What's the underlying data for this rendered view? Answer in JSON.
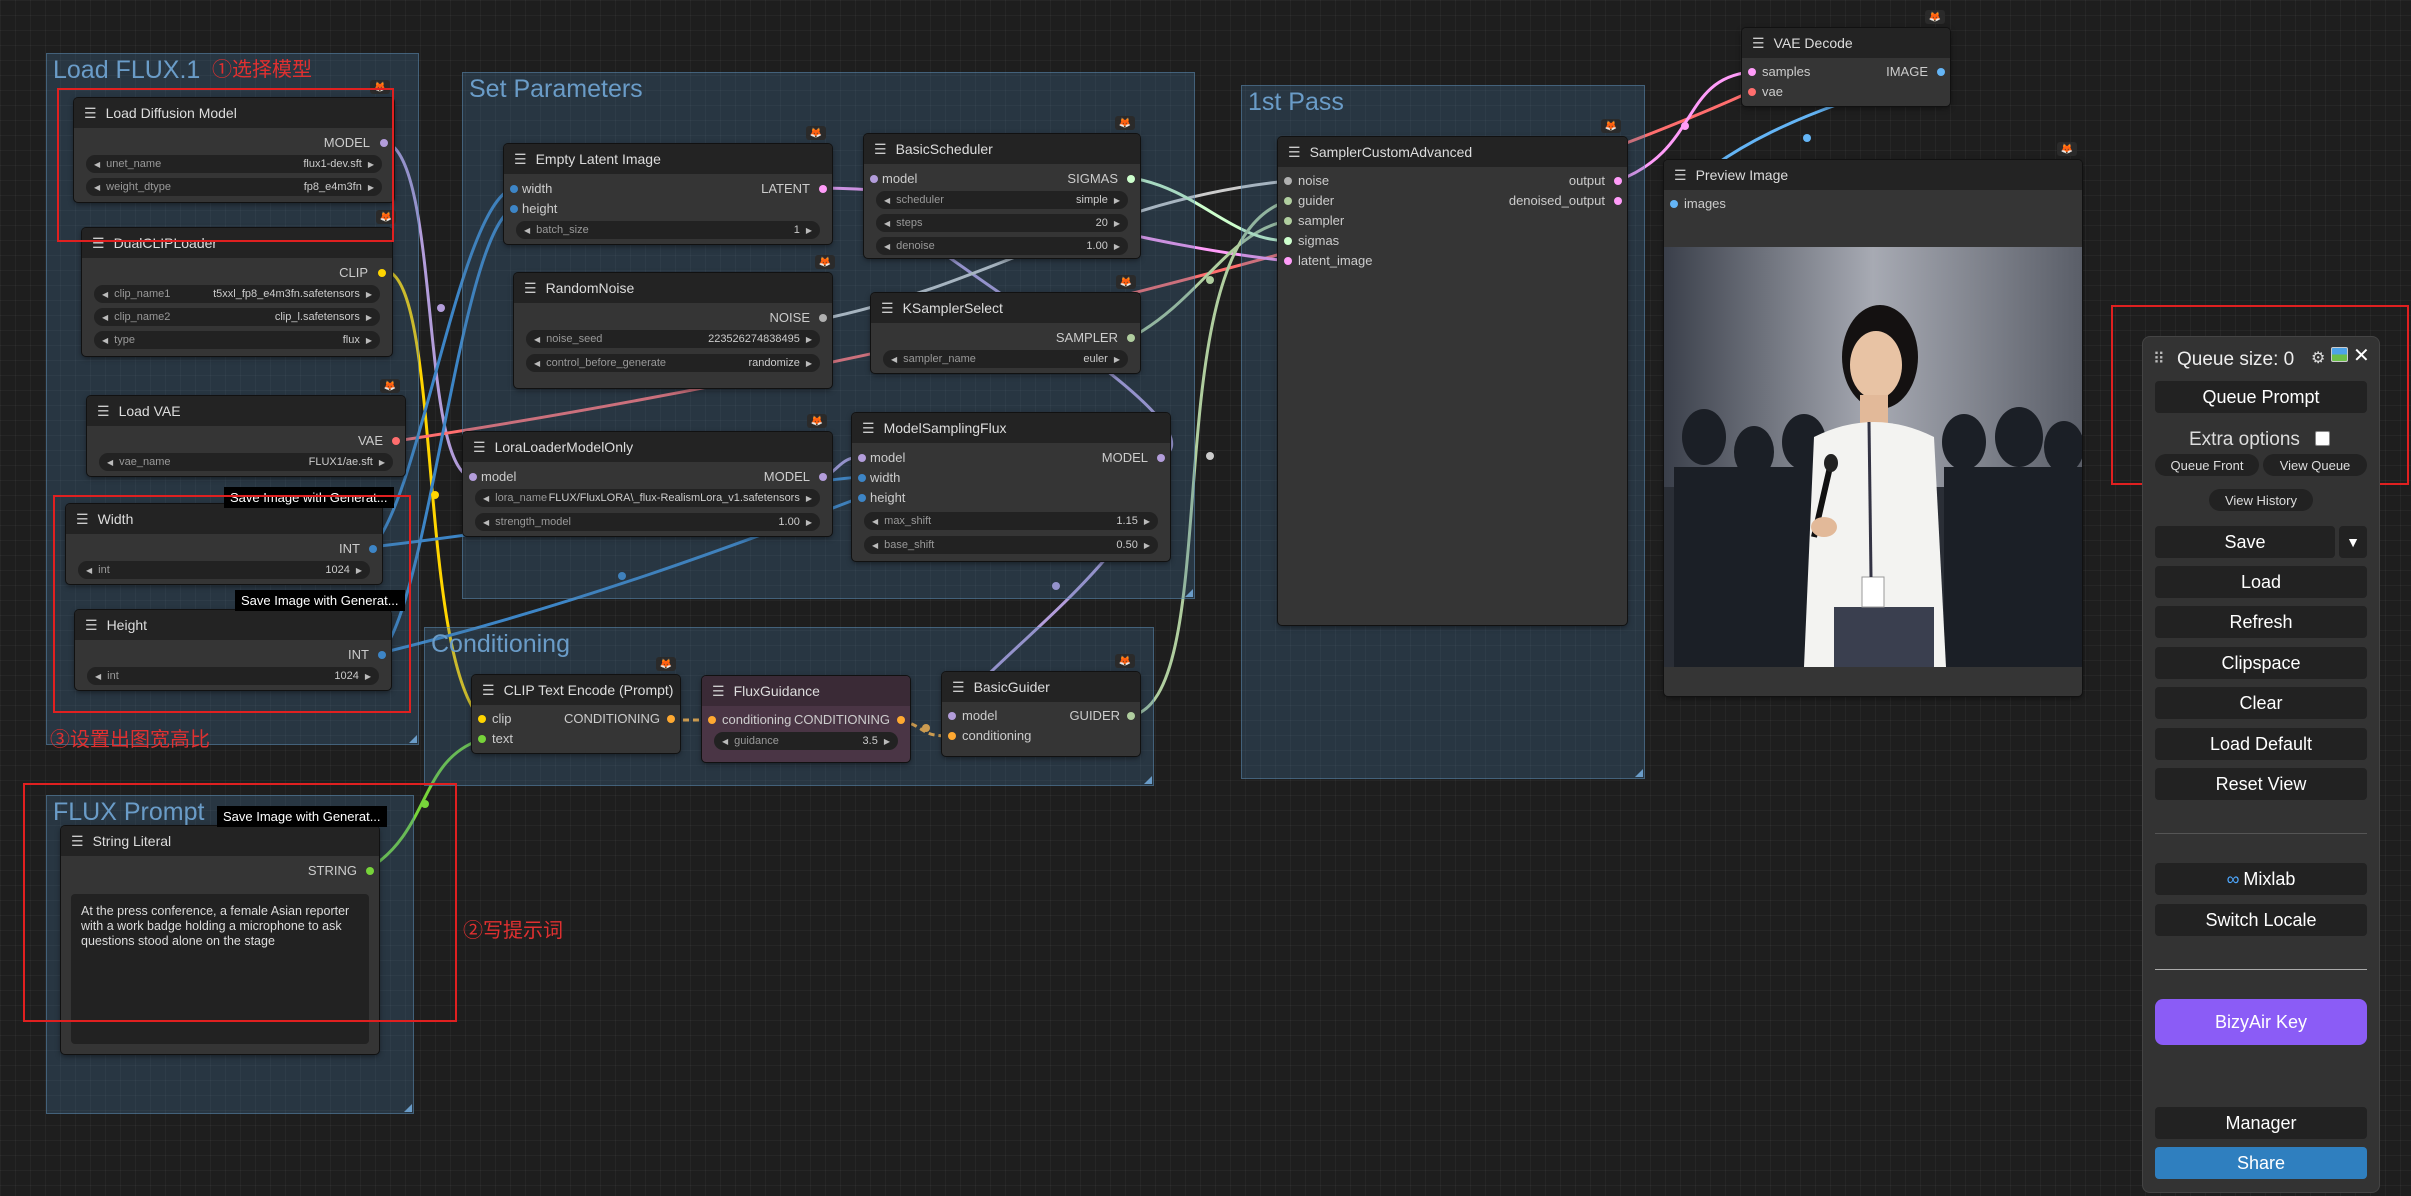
{
  "groups": {
    "load_flux": "Load FLUX.1",
    "set_parameters": "Set Parameters",
    "first_pass": "1st Pass",
    "conditioning": "Conditioning",
    "flux_prompt": "FLUX Prompt"
  },
  "annotations": {
    "choose_model": "①选择模型",
    "write_prompt": "②写提示词",
    "set_ratio": "③设置出图宽高比"
  },
  "badges": {
    "save_image_1": "Save Image with Generat...",
    "save_image_2": "Save Image with Generat...",
    "save_image_3": "Save Image with Generat..."
  },
  "nodes": {
    "load_diffusion": {
      "title": "Load Diffusion Model",
      "out": "MODEL",
      "w1_label": "unet_name",
      "w1_value": "flux1-dev.sft",
      "w2_label": "weight_dtype",
      "w2_value": "fp8_e4m3fn"
    },
    "dual_clip": {
      "title": "DualCLIPLoader",
      "out": "CLIP",
      "w1_label": "clip_name1",
      "w1_value": "t5xxl_fp8_e4m3fn.safetensors",
      "w2_label": "clip_name2",
      "w2_value": "clip_l.safetensors",
      "w3_label": "type",
      "w3_value": "flux"
    },
    "load_vae": {
      "title": "Load VAE",
      "out": "VAE",
      "w1_label": "vae_name",
      "w1_value": "FLUX1/ae.sft"
    },
    "width": {
      "title": "Width",
      "out": "INT",
      "w1_label": "int",
      "w1_value": "1024"
    },
    "height": {
      "title": "Height",
      "out": "INT",
      "w1_label": "int",
      "w1_value": "1024"
    },
    "string_literal": {
      "title": "String Literal",
      "out": "STRING",
      "text": "At the press conference, a female Asian reporter with a work badge holding a microphone to ask questions stood alone on the stage"
    },
    "empty_latent": {
      "title": "Empty Latent Image",
      "in1": "width",
      "in2": "height",
      "out": "LATENT",
      "w1_label": "batch_size",
      "w1_value": "1"
    },
    "random_noise": {
      "title": "RandomNoise",
      "out": "NOISE",
      "w1_label": "noise_seed",
      "w1_value": "223526274838495",
      "w2_label": "control_before_generate",
      "w2_value": "randomize"
    },
    "lora_loader": {
      "title": "LoraLoaderModelOnly",
      "in1": "model",
      "out": "MODEL",
      "w1_label": "lora_name",
      "w1_value": "FLUX/FluxLORA\\_flux-RealismLora_v1.safetensors",
      "w2_label": "strength_model",
      "w2_value": "1.00"
    },
    "basic_scheduler": {
      "title": "BasicScheduler",
      "in1": "model",
      "out": "SIGMAS",
      "w1_label": "scheduler",
      "w1_value": "simple",
      "w2_label": "steps",
      "w2_value": "20",
      "w3_label": "denoise",
      "w3_value": "1.00"
    },
    "ksampler_select": {
      "title": "KSamplerSelect",
      "out": "SAMPLER",
      "w1_label": "sampler_name",
      "w1_value": "euler"
    },
    "model_sampling": {
      "title": "ModelSamplingFlux",
      "in1": "model",
      "in2": "width",
      "in3": "height",
      "out": "MODEL",
      "w1_label": "max_shift",
      "w1_value": "1.15",
      "w2_label": "base_shift",
      "w2_value": "0.50"
    },
    "sampler_custom": {
      "title": "SamplerCustomAdvanced",
      "in1": "noise",
      "in2": "guider",
      "in3": "sampler",
      "in4": "sigmas",
      "in5": "latent_image",
      "out1": "output",
      "out2": "denoised_output"
    },
    "vae_decode": {
      "title": "VAE Decode",
      "in1": "samples",
      "in2": "vae",
      "out": "IMAGE"
    },
    "preview_image": {
      "title": "Preview Image",
      "in1": "images"
    },
    "clip_text_encode": {
      "title": "CLIP Text Encode (Prompt)",
      "in1": "clip",
      "in2": "text",
      "out": "CONDITIONING"
    },
    "flux_guidance": {
      "title": "FluxGuidance",
      "in1": "conditioning",
      "out": "CONDITIONING",
      "w1_label": "guidance",
      "w1_value": "3.5"
    },
    "basic_guider": {
      "title": "BasicGuider",
      "in1": "model",
      "in2": "conditioning",
      "out": "GUIDER"
    }
  },
  "panel": {
    "queue_size": "Queue size: 0",
    "queue_prompt": "Queue Prompt",
    "extra_options": "Extra options",
    "queue_front": "Queue Front",
    "view_queue": "View Queue",
    "view_history": "View History",
    "save": "Save",
    "load": "Load",
    "refresh": "Refresh",
    "clipspace": "Clipspace",
    "clear": "Clear",
    "load_default": "Load Default",
    "reset_view": "Reset View",
    "mixlab": "Mixlab",
    "switch_locale": "Switch Locale",
    "bizyair_key": "BizyAir Key",
    "manager": "Manager",
    "share": "Share"
  },
  "colors": {
    "model": "#b39ddb",
    "clip": "#ffd500",
    "vae": "#ff6e6e",
    "int": "#3d85c6",
    "latent": "#ff9cf9",
    "conditioning": "#ffa931",
    "string": "#77d43a",
    "noise": "#b0b0b0",
    "sampler": "#b0ce9f",
    "sigmas": "#cdffcd",
    "image": "#64b5f6",
    "annotation": "#e02020",
    "bizyair": "#8b5cf6",
    "share": "#2f7fbf"
  }
}
